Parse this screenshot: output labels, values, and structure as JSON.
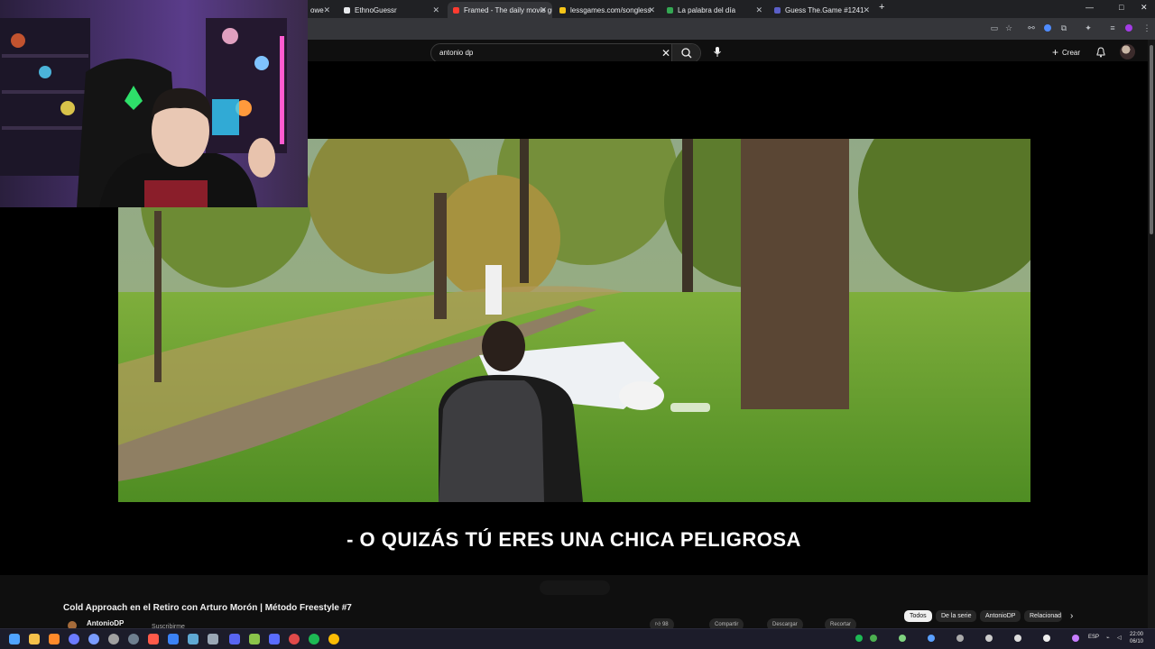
{
  "browser": {
    "tabs": [
      {
        "label": "owe",
        "active": false
      },
      {
        "label": "EthnoGuessr",
        "active": false
      },
      {
        "label": "Framed - The daily movie gues",
        "active": true
      },
      {
        "label": "lessgames.com/songless",
        "active": false
      },
      {
        "label": "La palabra del día",
        "active": false
      },
      {
        "label": "Guess The.Game #1241",
        "active": false
      }
    ],
    "new_tab": "+",
    "window_controls": [
      "—",
      "□",
      "✕"
    ]
  },
  "youtube": {
    "search_query": "antonio dp",
    "create_label": "Crear",
    "subtitle": "- O QUIZÁS TÚ ERES UNA CHICA PELIGROSA",
    "video_title": "Cold Approach en el Retiro con Arturo Morón | Método Freestyle #7",
    "channel_name": "AntonioDP",
    "subscribe_label": "Suscribirme",
    "like_count": "98",
    "actions": [
      "Compartir",
      "Descargar",
      "Recortar"
    ],
    "chips": [
      "Todos",
      "De la serie",
      "AntonioDP",
      "Relacionad"
    ]
  },
  "taskbar": {
    "language": "ESP",
    "time": "22:00",
    "date": "06/10"
  },
  "icons": {
    "search": "search-icon",
    "clear": "close-icon",
    "mic": "mic-icon",
    "create": "plus-icon",
    "bell": "bell-icon",
    "chevron": "chevron-right-icon"
  },
  "colors": {
    "accent": "#ff0000",
    "background": "#0f0f0f",
    "chrome": "#35363a"
  }
}
